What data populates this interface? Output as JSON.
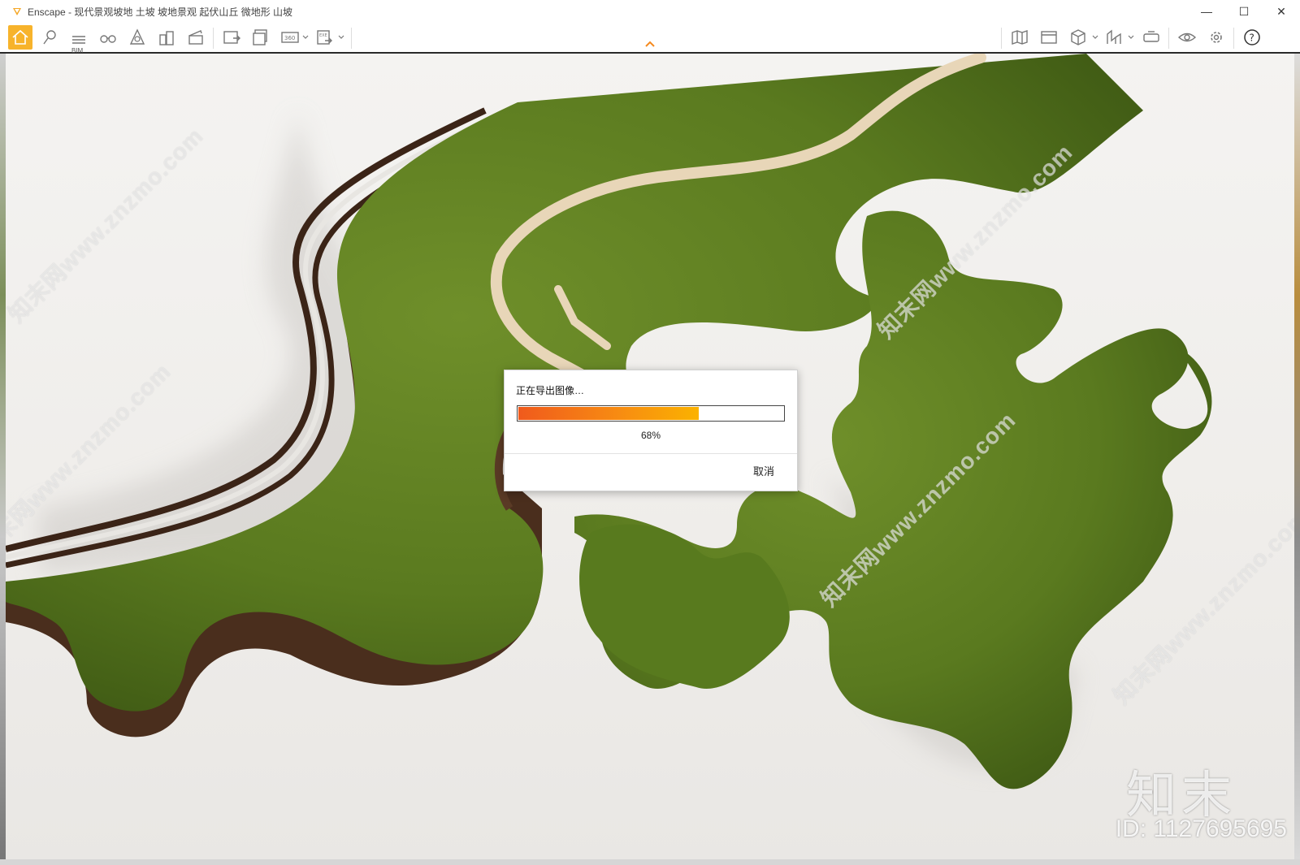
{
  "window": {
    "title": "Enscape - 现代景观坡地 土坡 坡地景观 起伏山丘 微地形 山坡",
    "minimize": "—",
    "maximize": "☐",
    "close": "✕"
  },
  "toolbar": {
    "bim_label": "BIM",
    "tools": [
      {
        "name": "home-icon",
        "active": true
      },
      {
        "name": "map-pin-icon"
      },
      {
        "name": "bim-list-icon"
      },
      {
        "name": "binoculars-icon"
      },
      {
        "name": "light-icon"
      },
      {
        "name": "buildings-icon"
      },
      {
        "name": "clapper-icon"
      },
      {
        "name": "export-image-icon"
      },
      {
        "name": "batch-export-icon"
      },
      {
        "name": "panorama-360-icon"
      },
      {
        "name": "export-exe-icon"
      },
      {
        "name": "map-icon"
      },
      {
        "name": "asset-library-icon"
      },
      {
        "name": "cube-icon"
      },
      {
        "name": "section-icon"
      },
      {
        "name": "vr-headset-icon"
      },
      {
        "name": "eye-icon"
      },
      {
        "name": "gear-icon"
      },
      {
        "name": "help-icon"
      }
    ],
    "accent_color": "#f7b32b"
  },
  "dialog": {
    "title": "正在导出图像…",
    "progress": 0.68,
    "progress_text": "68%",
    "cancel_label": "取消"
  },
  "watermarks": {
    "site_text": "知末网www.znzmo.com",
    "brand": "知末",
    "id": "ID: 1127695695"
  },
  "colors": {
    "grass": "#5f7d22",
    "grass_dark": "#3f5a14",
    "path": "#e8d6b8",
    "edge_wood": "#4a2e1d",
    "progress_start": "#f05a1c",
    "progress_end": "#fbb200"
  }
}
